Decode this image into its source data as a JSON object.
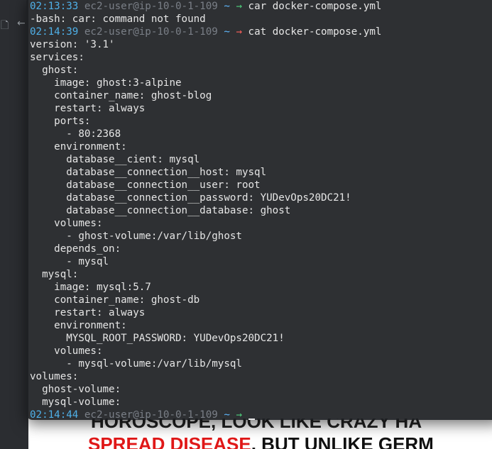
{
  "background_slide": {
    "line1": "HOROSCOPE, LOOK LIKE CRAZY HA",
    "line2_red": "SPREAD DISEASE",
    "line2_rest": ", BUT UNLIKE GERM"
  },
  "terminal": {
    "lines": [
      {
        "type": "prompt",
        "time": "02:13:33",
        "host": "ec2-user@ip-10-0-1-109",
        "dir": "~",
        "arrow": "→",
        "status": "ok",
        "command": "car docker-compose.yml"
      },
      {
        "type": "text",
        "text": "-bash: car: command not found"
      },
      {
        "type": "prompt",
        "time": "02:14:39",
        "host": "ec2-user@ip-10-0-1-109",
        "dir": "~",
        "arrow": "→",
        "status": "err",
        "command": "cat docker-compose.yml"
      },
      {
        "type": "text",
        "text": "version: '3.1'"
      },
      {
        "type": "text",
        "text": "services:"
      },
      {
        "type": "text",
        "text": "  ghost:"
      },
      {
        "type": "text",
        "text": "    image: ghost:3-alpine"
      },
      {
        "type": "text",
        "text": "    container_name: ghost-blog"
      },
      {
        "type": "text",
        "text": "    restart: always"
      },
      {
        "type": "text",
        "text": "    ports:"
      },
      {
        "type": "text",
        "text": "      - 80:2368"
      },
      {
        "type": "text",
        "text": "    environment:"
      },
      {
        "type": "text",
        "text": "      database__cient: mysql"
      },
      {
        "type": "text",
        "text": "      database__connection__host: mysql"
      },
      {
        "type": "text",
        "text": "      database__connection__user: root"
      },
      {
        "type": "text",
        "text": "      database__connection__password: YUDevOps20DC21!"
      },
      {
        "type": "text",
        "text": "      database__connection__database: ghost"
      },
      {
        "type": "text",
        "text": "    volumes:"
      },
      {
        "type": "text",
        "text": "      - ghost-volume:/var/lib/ghost"
      },
      {
        "type": "text",
        "text": "    depends_on:"
      },
      {
        "type": "text",
        "text": "      - mysql"
      },
      {
        "type": "text",
        "text": "  mysql:"
      },
      {
        "type": "text",
        "text": "    image: mysql:5.7"
      },
      {
        "type": "text",
        "text": "    container_name: ghost-db"
      },
      {
        "type": "text",
        "text": "    restart: always"
      },
      {
        "type": "text",
        "text": "    environment:"
      },
      {
        "type": "text",
        "text": "      MYSQL_ROOT_PASSWORD: YUDevOps20DC21!"
      },
      {
        "type": "text",
        "text": "    volumes:"
      },
      {
        "type": "text",
        "text": "      - mysql-volume:/var/lib/mysql"
      },
      {
        "type": "text",
        "text": "volumes:"
      },
      {
        "type": "text",
        "text": "  ghost-volume:"
      },
      {
        "type": "text",
        "text": "  mysql-volume:"
      },
      {
        "type": "prompt",
        "time": "02:14:44",
        "host": "ec2-user@ip-10-0-1-109",
        "dir": "~",
        "arrow": "→",
        "status": "ok",
        "command": "",
        "cursor": true
      }
    ]
  },
  "colors": {
    "time": "#4fb0e8",
    "host": "#7a7f87",
    "arrow_ok": "#4fd17c",
    "arrow_err": "#ff5f5a",
    "terminal_bg": "#1e2024",
    "text": "#e6e6e6"
  },
  "icons": {
    "left_strip": [
      "file-icon",
      "back-arrow-icon"
    ]
  }
}
